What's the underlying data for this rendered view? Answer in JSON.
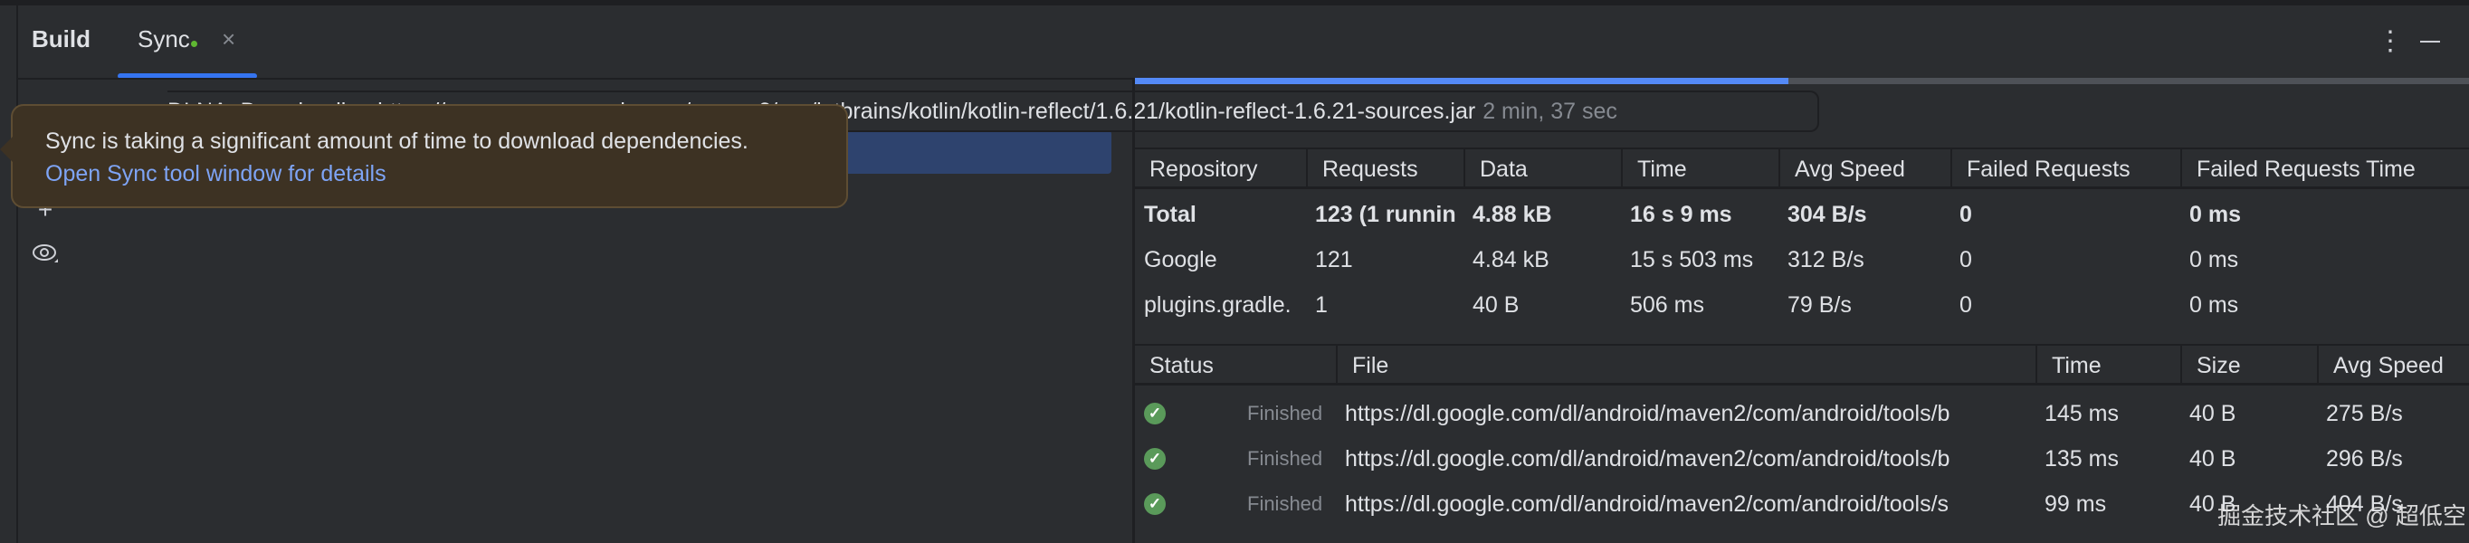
{
  "tabs": [
    {
      "label": "Build"
    },
    {
      "label": "Sync"
    }
  ],
  "tab_close": "×",
  "toolbar": {
    "more_icon": "⋮"
  },
  "download": {
    "text": "DLNA: Downloading https://repo.maven.apache.org/maven2/org/jetbrains/kotlin/kotlin-reflect/1.6.21/kotlin-reflect-1.6.21-sources.jar",
    "elapsed": "2 min, 37 sec"
  },
  "tooltip": {
    "message": "Sync is taking a significant amount of time to download dependencies.",
    "link": "Open Sync tool window for details"
  },
  "progress": {
    "fraction": 0.49
  },
  "repo_table": {
    "columns": [
      "Repository",
      "Requests",
      "Data",
      "Time",
      "Avg Speed",
      "Failed Requests",
      "Failed Requests Time"
    ],
    "rows": [
      [
        "Total",
        "123 (1 runnin",
        "4.88 kB",
        "16 s 9 ms",
        "304 B/s",
        "0",
        "0 ms"
      ],
      [
        "Google",
        "121",
        "4.84 kB",
        "15 s 503 ms",
        "312 B/s",
        "0",
        "0 ms"
      ],
      [
        "plugins.gradle.",
        "1",
        "40 B",
        "506 ms",
        "79 B/s",
        "0",
        "0 ms"
      ]
    ]
  },
  "file_table": {
    "columns": [
      "Status",
      "File",
      "Time",
      "Size",
      "Avg Speed"
    ],
    "rows": [
      [
        "Finished",
        "https://dl.google.com/dl/android/maven2/com/android/tools/b",
        "145 ms",
        "40 B",
        "275 B/s"
      ],
      [
        "Finished",
        "https://dl.google.com/dl/android/maven2/com/android/tools/b",
        "135 ms",
        "40 B",
        "296 B/s"
      ],
      [
        "Finished",
        "https://dl.google.com/dl/android/maven2/com/android/tools/s",
        "99 ms",
        "40 B",
        "404 B/s"
      ]
    ]
  },
  "watermark": "掘金技术社区 @ 超低空",
  "colors": {
    "accent": "#3574f0",
    "background": "#2b2d30",
    "tooltip": "#3d3223",
    "link": "#7ea4f5",
    "success": "#5a9a5a"
  }
}
